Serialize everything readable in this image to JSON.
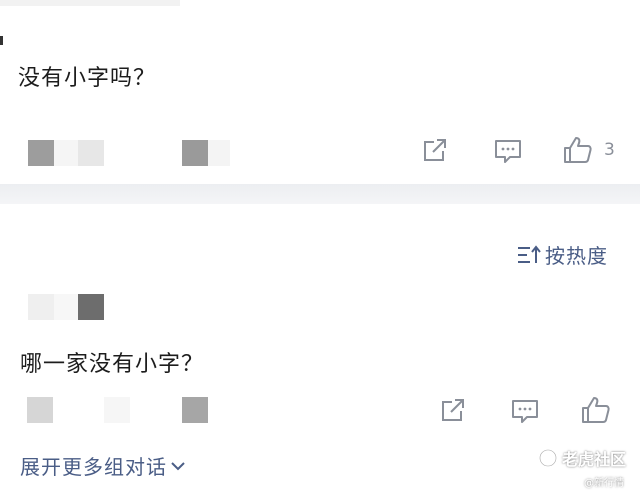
{
  "colors": {
    "accent": "#4a5d86",
    "icon_gray": "#8a8f99",
    "divider": "#eceef1"
  },
  "post1": {
    "text": "没有小字吗？",
    "actions": {
      "share_icon": "share-box-arrow-icon",
      "comment_icon": "comment-icon",
      "like_icon": "thumbs-up-icon",
      "like_count": "3"
    }
  },
  "sort": {
    "icon": "sort-icon",
    "label": "按热度"
  },
  "post2": {
    "text": "哪一家没有小字？",
    "actions": {
      "share_icon": "share-box-arrow-icon",
      "comment_icon": "comment-icon",
      "like_icon": "thumbs-up-icon"
    }
  },
  "expand": {
    "label": "展开更多组对话",
    "icon": "chevron-down-icon"
  },
  "watermark": {
    "brand": "老虎社区",
    "sub": "@新行情"
  }
}
